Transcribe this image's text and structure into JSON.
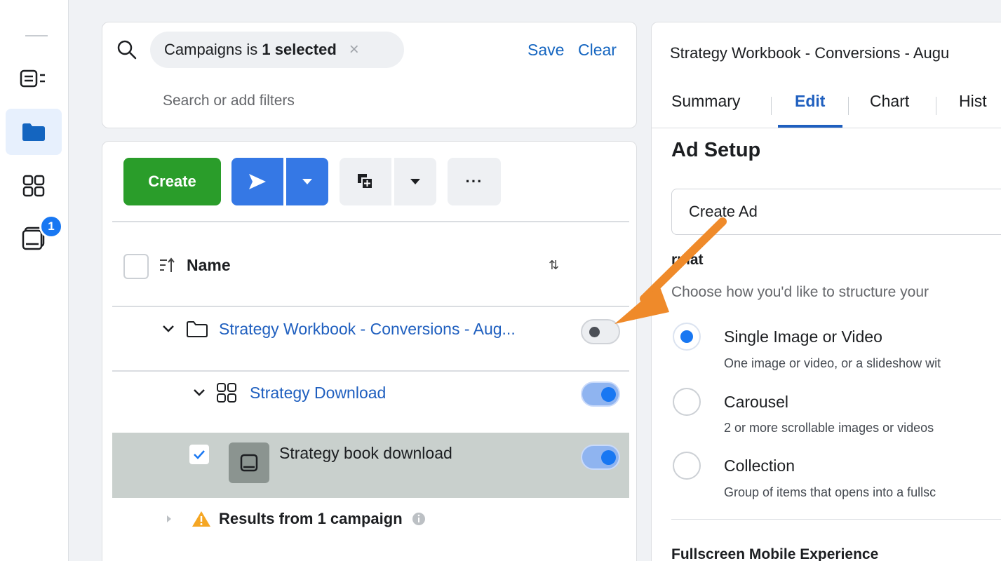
{
  "sidebar": {
    "icons": [
      "ads-manager-icon",
      "folder-icon",
      "grid-icon",
      "ad-creative-icon"
    ],
    "badge_count": "1"
  },
  "filter": {
    "chip_prefix": "Campaigns is ",
    "chip_bold": "1 selected",
    "save_label": "Save",
    "clear_label": "Clear",
    "placeholder": "Search or add filters"
  },
  "toolbar": {
    "create_label": "Create",
    "more_label": "···"
  },
  "table": {
    "header_name": "Name",
    "sort_glyph": "⇅",
    "campaign_name": "Strategy Workbook - Conversions - Aug...",
    "adset_name": "Strategy Download",
    "ad_name": "Strategy book download",
    "results_label": "Results from 1 campaign",
    "toggles": {
      "campaign": false,
      "adset": true,
      "ad": true
    }
  },
  "panel": {
    "title": "Strategy Workbook - Conversions - Augu",
    "tabs": [
      "Summary",
      "Edit",
      "Chart",
      "Hist"
    ],
    "active_tab": "Edit",
    "section_title": "Ad Setup",
    "create_ad_label": "Create Ad",
    "format_label": "rmat",
    "format_hint": "Choose how you'd like to structure your",
    "options": [
      {
        "title": "Single Image or Video",
        "desc": "One image or video, or a slideshow wit",
        "checked": true
      },
      {
        "title": "Carousel",
        "desc": "2 or more scrollable images or videos",
        "checked": false
      },
      {
        "title": "Collection",
        "desc": "Group of items that opens into a fullsc",
        "checked": false
      }
    ],
    "fullscreen_title": "Fullscreen Mobile Experience"
  },
  "colors": {
    "accent_blue": "#1877f2",
    "link_blue": "#1f5fbf",
    "create_green": "#2a9d2a",
    "annotation_orange": "#ef8a2a"
  }
}
